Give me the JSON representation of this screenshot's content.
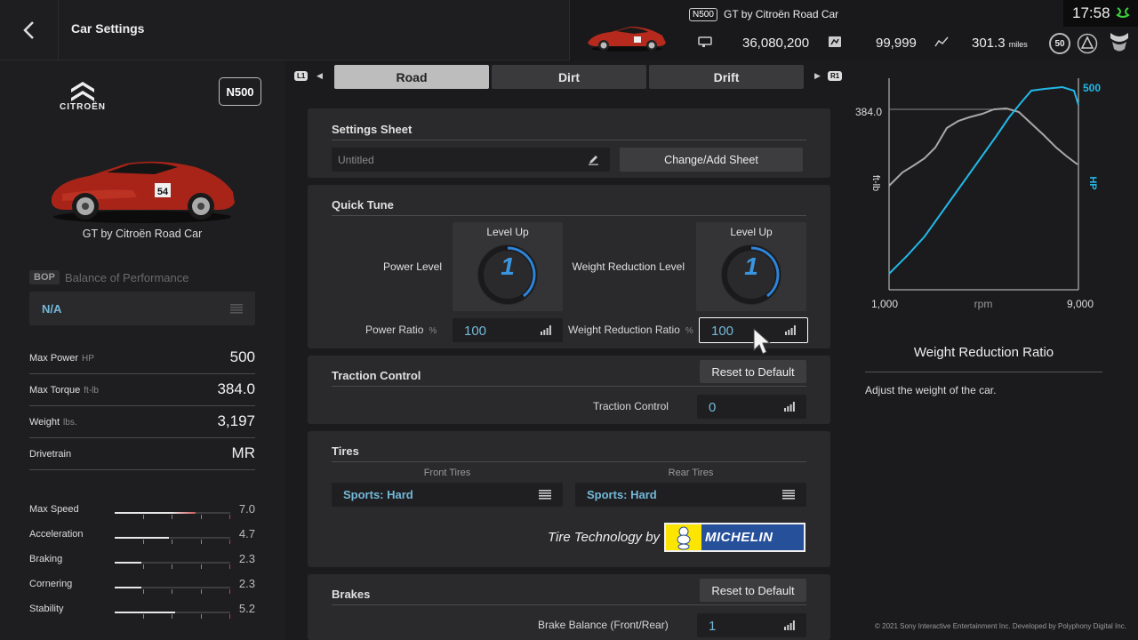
{
  "header": {
    "title": "Car Settings",
    "car_badge": "N500",
    "car_name": "GT by Citroën Road Car",
    "credits": "36,080,200",
    "mileage_points": "99,999",
    "odometer": "301.3",
    "odometer_unit": "miles",
    "level": "50",
    "clock": "17:58"
  },
  "sidebar": {
    "brand": "CITROËN",
    "category_badge": "N500",
    "car_name": "GT by Citroën Road Car",
    "bop_badge": "BOP",
    "bop_label": "Balance of Performance",
    "bop_value": "N/A",
    "specs": [
      {
        "label": "Max Power",
        "unit": "HP",
        "value": "500"
      },
      {
        "label": "Max Torque",
        "unit": "ft-lb",
        "value": "384.0"
      },
      {
        "label": "Weight",
        "unit": "lbs.",
        "value": "3,197"
      },
      {
        "label": "Drivetrain",
        "unit": "",
        "value": "MR"
      }
    ],
    "performance": [
      {
        "label": "Max Speed",
        "value": "7.0",
        "fill": 0.7
      },
      {
        "label": "Acceleration",
        "value": "4.7",
        "fill": 0.47
      },
      {
        "label": "Braking",
        "value": "2.3",
        "fill": 0.23
      },
      {
        "label": "Cornering",
        "value": "2.3",
        "fill": 0.23
      },
      {
        "label": "Stability",
        "value": "5.2",
        "fill": 0.52
      }
    ]
  },
  "tabs": {
    "left_button": "L1",
    "right_button": "R1",
    "items": [
      "Road",
      "Dirt",
      "Drift"
    ],
    "active": "Road"
  },
  "settings_sheet": {
    "title": "Settings Sheet",
    "sheet_name": "Untitled",
    "change_button": "Change/Add Sheet"
  },
  "quick_tune": {
    "title": "Quick Tune",
    "power_level_label": "Power Level",
    "weight_level_label": "Weight Reduction Level",
    "level_up": "Level Up",
    "power_level": "1",
    "weight_level": "1",
    "power_ratio_label": "Power Ratio",
    "weight_ratio_label": "Weight Reduction Ratio",
    "ratio_unit": "%",
    "power_ratio": "100",
    "weight_ratio": "100"
  },
  "traction": {
    "title": "Traction Control",
    "reset_button": "Reset to Default",
    "label": "Traction Control",
    "value": "0"
  },
  "tires": {
    "title": "Tires",
    "front_label": "Front Tires",
    "rear_label": "Rear Tires",
    "front_value": "Sports: Hard",
    "rear_value": "Sports: Hard",
    "sponsor_text": "Tire Technology by",
    "sponsor_logo": "MICHELIN"
  },
  "brakes": {
    "title": "Brakes",
    "reset_button": "Reset to Default",
    "balance_label": "Brake Balance (Front/Rear)",
    "balance_value": "1"
  },
  "graph": {
    "torque_peak": "384.0",
    "power_peak": "500",
    "left_axis_label": "ft-lb",
    "right_axis_label": "HP",
    "x_min": "1,000",
    "x_label": "rpm",
    "x_max": "9,000",
    "torque_color": "#a8a8a8",
    "power_color": "#22b8e8"
  },
  "help": {
    "title": "Weight Reduction Ratio",
    "text": "Adjust the weight of the car."
  },
  "footer": {
    "copyright": "© 2021 Sony Interactive Entertainment Inc. Developed by Polyphony Digital Inc."
  }
}
